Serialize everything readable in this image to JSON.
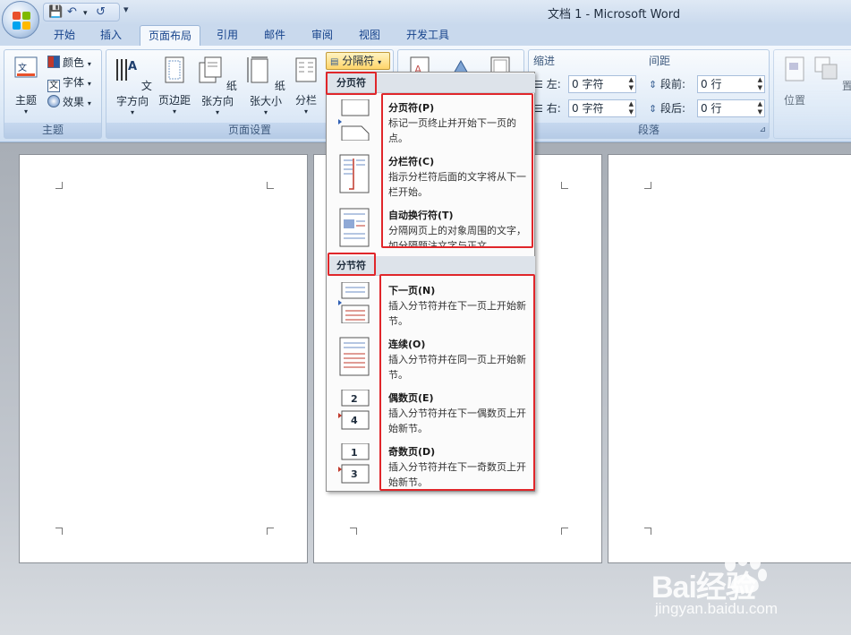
{
  "window": {
    "title": "文档 1 - Microsoft Word"
  },
  "quick_access": {
    "more": "▾"
  },
  "tabs": [
    "开始",
    "插入",
    "页面布局",
    "引用",
    "邮件",
    "审阅",
    "视图",
    "开发工具"
  ],
  "active_tab": "页面布局",
  "ribbon": {
    "theme_group": {
      "label": "主题",
      "theme_button": "主题",
      "colors": "颜色",
      "fonts": "字体",
      "effects": "效果"
    },
    "page_setup_group": {
      "label": "页面设置",
      "text_direction": "文字方向",
      "margins": "页边距",
      "orientation": "纸张方向",
      "size": "纸张大小",
      "columns": "分栏",
      "breaks": "分隔符"
    },
    "paragraph_group": {
      "label": "段落",
      "indent_label": "缩进",
      "spacing_label": "间距",
      "indent_left_label": "左:",
      "indent_left_value": "0 字符",
      "indent_right_label": "右:",
      "indent_right_value": "0 字符",
      "space_before_label": "段前:",
      "space_before_value": "0 行",
      "space_after_label": "段后:",
      "space_after_value": "0 行"
    },
    "arrange_group": {
      "position": "位置",
      "bring_front": "置于顶"
    }
  },
  "breaks_menu": {
    "page_breaks_header": "分页符",
    "section_breaks_header": "分节符",
    "page_breaks": [
      {
        "title": "分页符(P)",
        "desc": "标记一页终止并开始下一页的点。"
      },
      {
        "title": "分栏符(C)",
        "desc": "指示分栏符后面的文字将从下一栏开始。"
      },
      {
        "title": "自动换行符(T)",
        "desc": "分隔网页上的对象周围的文字，如分隔题注文字与正文"
      }
    ],
    "section_breaks": [
      {
        "title": "下一页(N)",
        "desc": "插入分节符并在下一页上开始新节。"
      },
      {
        "title": "连续(O)",
        "desc": "插入分节符并在同一页上开始新节。"
      },
      {
        "title": "偶数页(E)",
        "desc": "插入分节符并在下一偶数页上开始新节。"
      },
      {
        "title": "奇数页(D)",
        "desc": "插入分节符并在下一奇数页上开始新节。"
      }
    ]
  },
  "watermark": {
    "brand": "Bai经验",
    "url": "jingyan.baidu.com"
  },
  "colors": {
    "highlight": "#e0262a",
    "ribbon_text": "#15428b"
  }
}
